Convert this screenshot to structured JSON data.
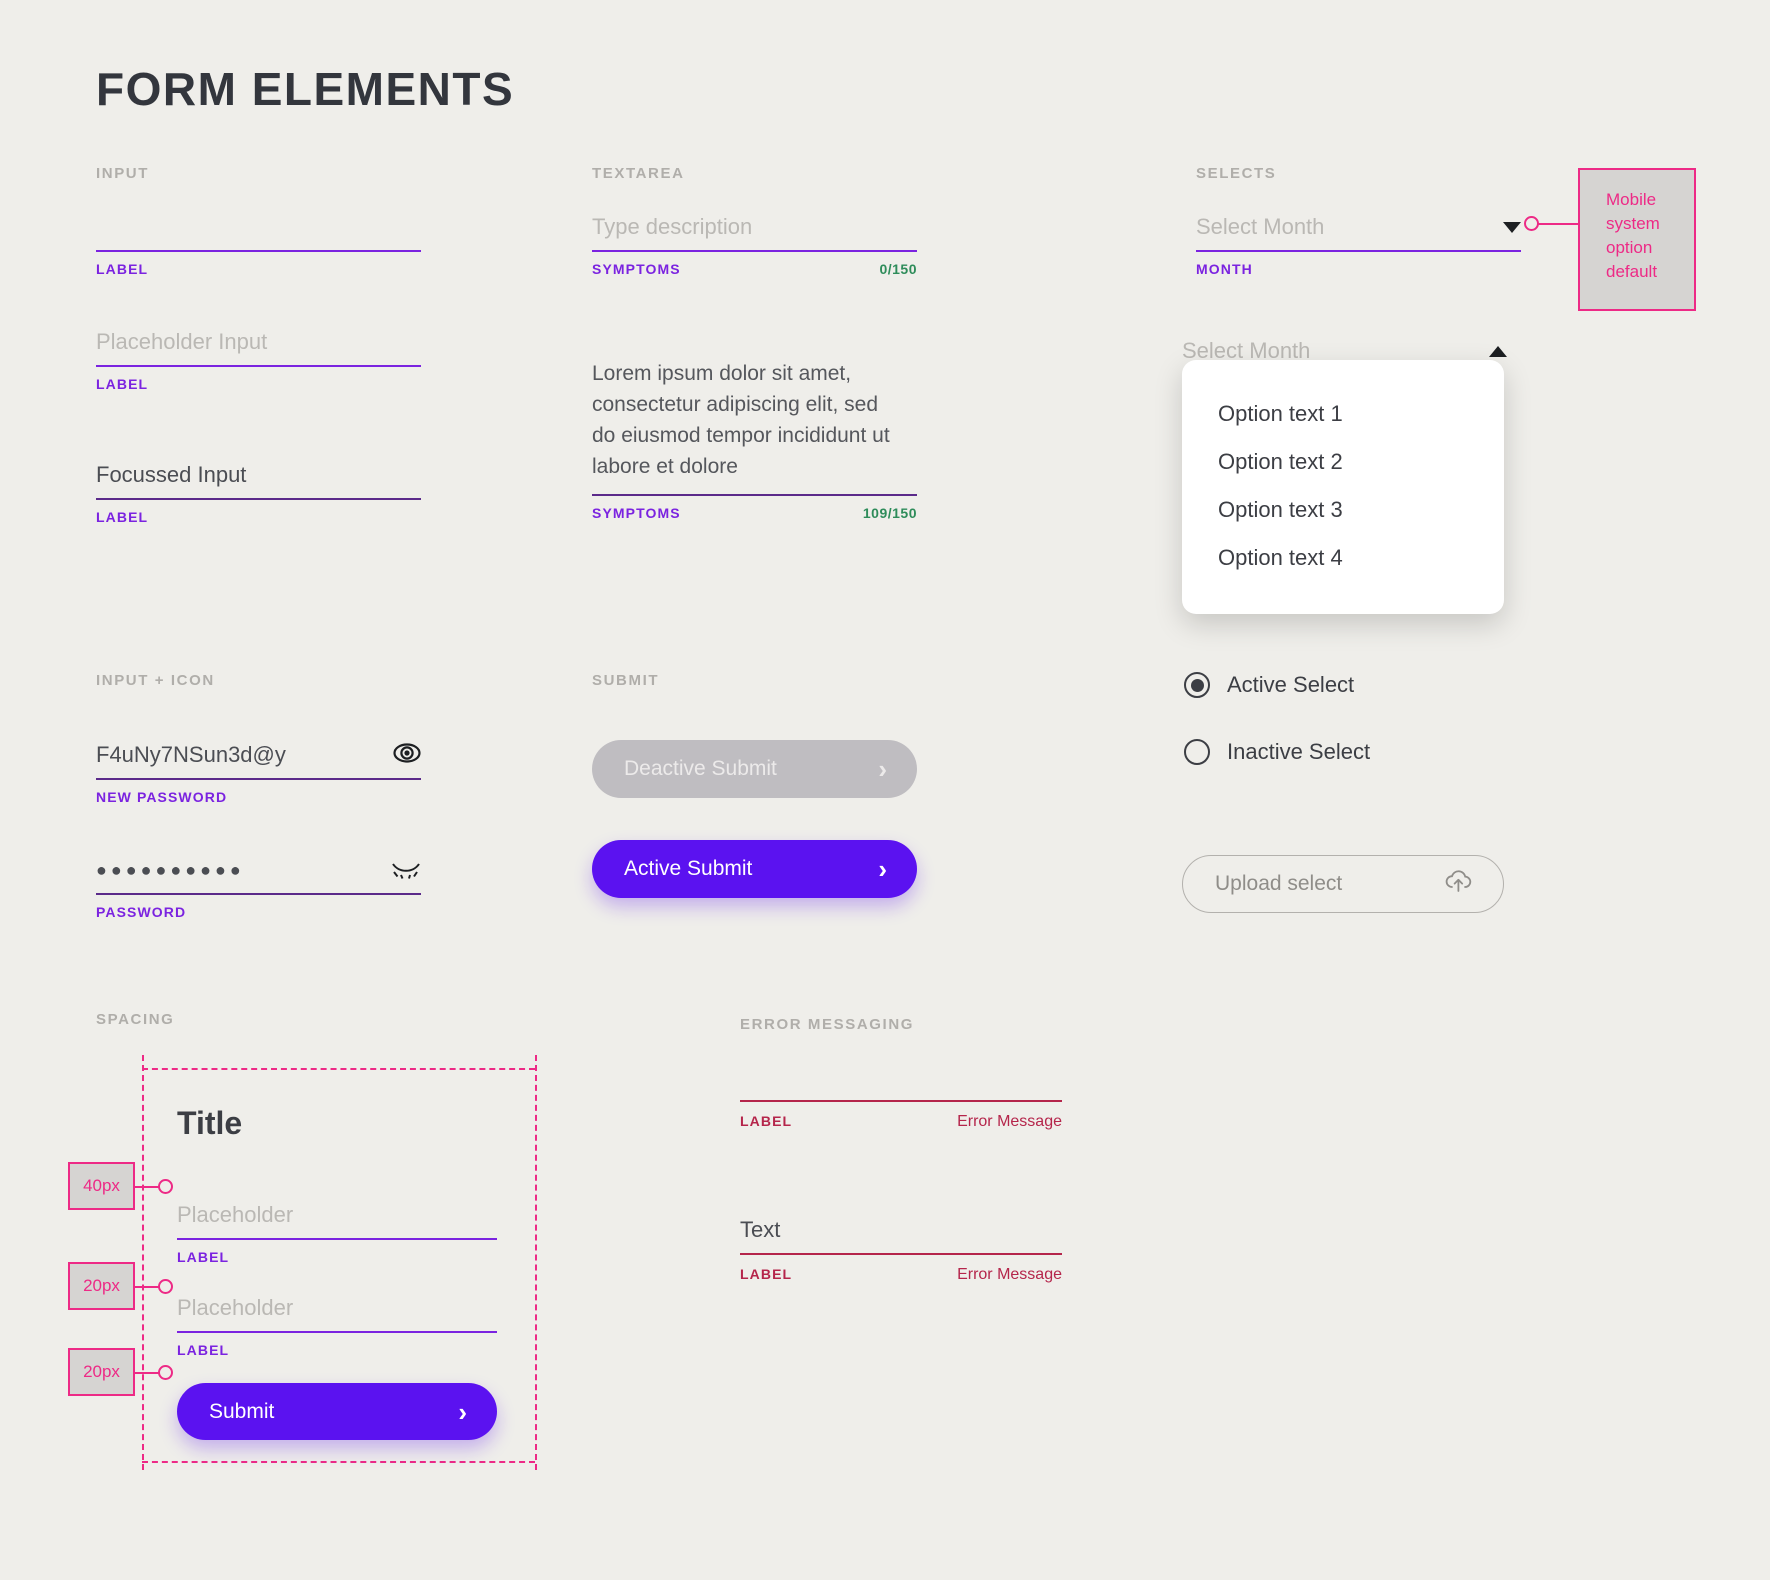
{
  "page": {
    "title": "FORM ELEMENTS"
  },
  "colors": {
    "background": "#efeeea",
    "accent_purple": "#7b23e0",
    "button_purple": "#5b12f0",
    "annotation_pink": "#ed2a86",
    "error_red": "#b5254b",
    "counter_green": "#2e8c5a",
    "section_label_grey": "#b0aeaa"
  },
  "sections": {
    "input": {
      "label": "INPUT"
    },
    "textarea": {
      "label": "TEXTAREA"
    },
    "selects": {
      "label": "SELECTS"
    },
    "input_icon": {
      "label": "INPUT + ICON"
    },
    "submit": {
      "label": "SUBMIT"
    },
    "spacing": {
      "label": "SPACING"
    },
    "error": {
      "label": "ERROR MESSAGING"
    }
  },
  "inputs": [
    {
      "value": "",
      "placeholder": "",
      "sub_label": "LABEL"
    },
    {
      "value": "",
      "placeholder": "Placeholder Input",
      "sub_label": "LABEL"
    },
    {
      "value": "Focussed Input",
      "placeholder": "",
      "sub_label": "LABEL"
    }
  ],
  "textareas": [
    {
      "placeholder": "Type description",
      "value": "",
      "sub_label": "SYMPTOMS",
      "counter": "0/150"
    },
    {
      "placeholder": "",
      "value": "Lorem ipsum dolor sit amet,\nconsectetur adipiscing elit, sed\ndo eiusmod tempor incididunt ut\nlabore et dolore",
      "sub_label": "SYMPTOMS",
      "counter": "109/150"
    }
  ],
  "selects": {
    "closed": {
      "placeholder": "Select Month",
      "sub_label": "MONTH",
      "caret": "chevron-down-icon"
    },
    "open": {
      "placeholder": "Select Month",
      "caret": "chevron-up-icon",
      "options": [
        "Option text 1",
        "Option text 2",
        "Option text 3",
        "Option text 4"
      ]
    },
    "annotation": "Mobile system option default"
  },
  "input_icon": [
    {
      "value": "F4uNy7NSun3d@y",
      "sub_label": "NEW PASSWORD",
      "icon": "eye-icon"
    },
    {
      "value": "●●●●●●●●●●",
      "sub_label": "PASSWORD",
      "icon": "eye-off-icon"
    }
  ],
  "submit_buttons": [
    {
      "label": "Deactive Submit",
      "state": "deactive",
      "icon": "chevron-right-icon"
    },
    {
      "label": "Active Submit",
      "state": "active",
      "icon": "chevron-right-icon"
    }
  ],
  "radios": [
    {
      "label": "Active Select",
      "selected": true
    },
    {
      "label": "Inactive Select",
      "selected": false
    }
  ],
  "upload": {
    "label": "Upload select",
    "icon": "cloud-upload-icon"
  },
  "spacing_demo": {
    "title": "Title",
    "fields": [
      {
        "placeholder": "Placeholder",
        "sub_label": "LABEL"
      },
      {
        "placeholder": "Placeholder",
        "sub_label": "LABEL"
      }
    ],
    "submit": {
      "label": "Submit",
      "icon": "chevron-right-icon"
    },
    "measures": [
      "40px",
      "20px",
      "20px"
    ]
  },
  "errors": [
    {
      "value": "",
      "sub_label": "LABEL",
      "message": "Error Message"
    },
    {
      "value": "Text",
      "sub_label": "LABEL",
      "message": "Error Message"
    }
  ]
}
